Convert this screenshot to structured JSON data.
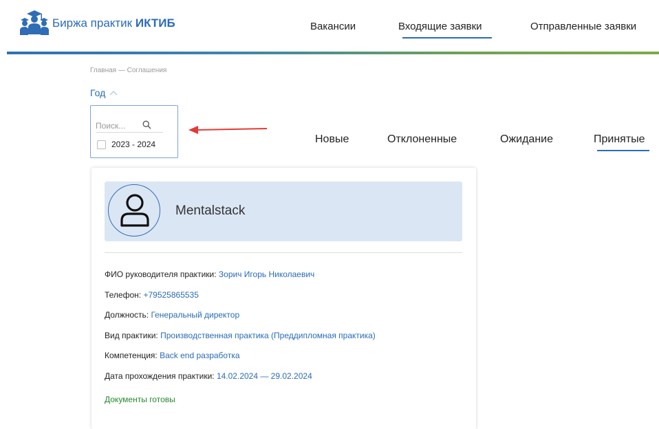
{
  "header": {
    "logo_text": "Биржа практик",
    "logo_bold": "ИКТИБ",
    "nav": [
      {
        "label": "Вакансии"
      },
      {
        "label": "Входящие заявки"
      },
      {
        "label": "Отправленные заявки"
      }
    ]
  },
  "breadcrumb": "Главная — Соглашения",
  "filter": {
    "title": "Год",
    "search_placeholder": "Поиск...",
    "options": [
      {
        "label": "2023 - 2024"
      }
    ]
  },
  "tabs": [
    {
      "label": "Новые"
    },
    {
      "label": "Отклоненные"
    },
    {
      "label": "Ожидание"
    },
    {
      "label": "Принятые"
    }
  ],
  "card": {
    "company_name": "Mentalstack",
    "fields": [
      {
        "label": "ФИО руководителя практики:",
        "value": "Зорич Игорь Николаевич"
      },
      {
        "label": "Телефон:",
        "value": "+79525865535"
      },
      {
        "label": "Должность:",
        "value": "Генеральный директор"
      },
      {
        "label": "Вид практики:",
        "value": "Производственная практика (Преддипломная практика)"
      },
      {
        "label": "Компетенция:",
        "value": "Back end разработка"
      },
      {
        "label": "Дата прохождения практики:",
        "value": "14.02.2024 — 29.02.2024"
      }
    ],
    "status": "Документы готовы"
  },
  "colors": {
    "accent_blue": "#2a6bb8",
    "arrow_red": "#e53935",
    "status_green": "#27892f",
    "card_header_bg": "#dbe6f4"
  }
}
